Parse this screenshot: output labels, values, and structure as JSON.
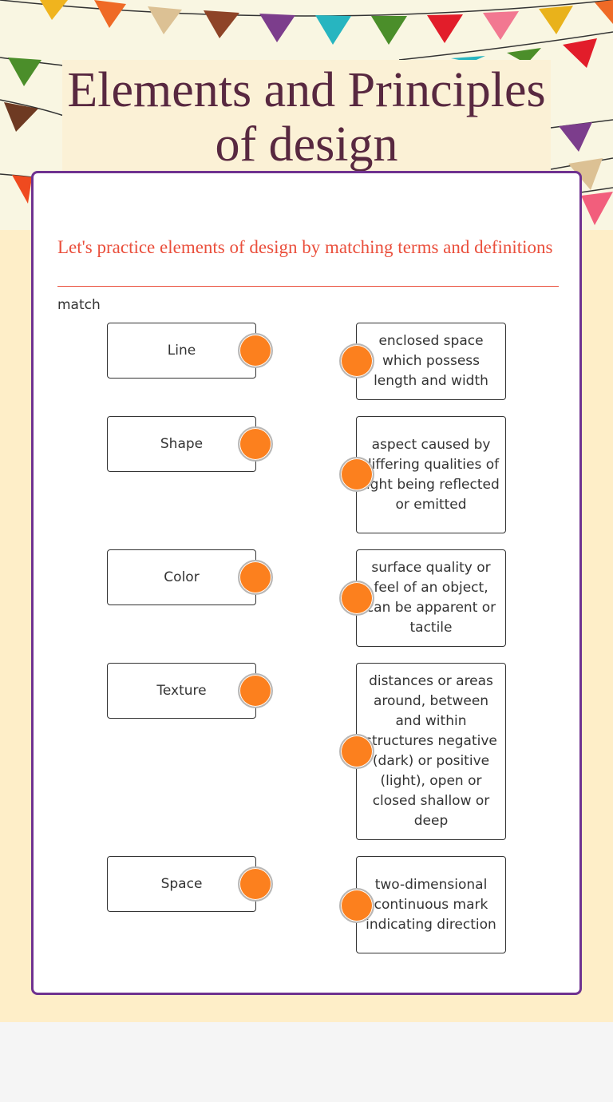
{
  "header": {
    "title": "Elements and Principles of design",
    "decoration": "bunting-flags",
    "bunting_colors": [
      "#f0b41e",
      "#ef6a26",
      "#dcc194",
      "#8e4427",
      "#7c3d8c",
      "#27b5c0",
      "#4b8e2a",
      "#e21d2a",
      "#f27891",
      "#e9b21b",
      "#a5d2d0"
    ]
  },
  "activity": {
    "instructions": "Let's practice elements of design by matching terms and definitions",
    "type_label": "match",
    "accent_color": "#ea4f3c",
    "border_color": "#6f3290",
    "connector_color": "#fc801e",
    "terms": [
      {
        "label": "Line"
      },
      {
        "label": "Shape"
      },
      {
        "label": "Color"
      },
      {
        "label": "Texture"
      },
      {
        "label": "Space"
      }
    ],
    "definitions": [
      {
        "label": "enclosed space which possess length and width"
      },
      {
        "label": "aspect caused by differing qualities of light being reflected or emitted"
      },
      {
        "label": "surface quality or feel of an object, can be apparent or tactile"
      },
      {
        "label": "distances or areas around, between and within structures negative (dark) or positive (light), open or closed shallow or deep"
      },
      {
        "label": "two-dimensional continuous mark indicating direction"
      }
    ]
  }
}
